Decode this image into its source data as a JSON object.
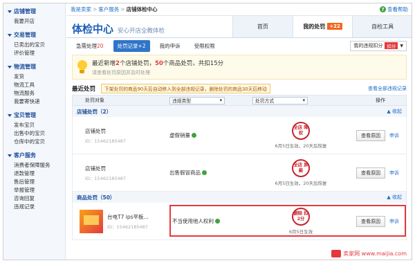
{
  "sidebar": {
    "sections": [
      {
        "title": "店铺管理",
        "items": [
          "我要开店"
        ]
      },
      {
        "title": "交易管理",
        "items": [
          "已卖出的宝贝",
          "评价管理"
        ]
      },
      {
        "title": "物流管理",
        "items": [
          "发货",
          "物流工具",
          "物流服务",
          "我要寄快递"
        ]
      },
      {
        "title": "宝贝管理",
        "items": [
          "发布宝贝",
          "出售中的宝贝",
          "仓库中的宝贝"
        ]
      },
      {
        "title": "客户服务",
        "items": [
          "消费者保障服务",
          "退款管理",
          "售后管理",
          "举报管理",
          "咨询回复",
          "违规记录"
        ]
      }
    ]
  },
  "breadcrumb": {
    "home": "我是卖家",
    "level2": "客户服务",
    "current": "店铺体检中心",
    "sep": ">"
  },
  "help_label": "查看帮助",
  "header": {
    "title": "体检中心",
    "subtitle": "安心开店全教体检"
  },
  "tabs": [
    {
      "label": "首页"
    },
    {
      "label": "我的处罚",
      "count": "+22"
    },
    {
      "label": "自检工具"
    }
  ],
  "subtabs": [
    {
      "label": "急需处理",
      "count": "20"
    },
    {
      "label": "处罚记录+2"
    },
    {
      "label": "我的申诉"
    },
    {
      "label": "受限权限"
    }
  ],
  "points_select": {
    "label": "我的违规扣分",
    "badge": "扣分"
  },
  "notice": {
    "prefix": "最近新增",
    "shop_count": "2",
    "mid": "个店铺处罚，",
    "item_count": "50",
    "suffix": "个商品处罚，共扣15分",
    "sub": "请查看处罚原因并及时处理"
  },
  "recent": {
    "title": "最近处罚",
    "tip": "下架处罚的商品90天后自动移入到全部违规记录，删除处罚的商品30天后移动",
    "all_link": "查看全部违规记录"
  },
  "table": {
    "col_object": "处罚对象",
    "col_type": "违规类型",
    "col_method": "处罚方式",
    "col_ops": "操作"
  },
  "groups": {
    "shop": {
      "title": "店铺处罚（2）",
      "fold": "收起"
    },
    "goods": {
      "title": "商品处罚（50）",
      "fold": "收起"
    }
  },
  "rows": [
    {
      "name": "店铺处罚",
      "id": "ID：15462185487",
      "type": "虚假销量",
      "stamp": "全店 降权",
      "note": "6月5日生效，20天后恢复",
      "btn": "查看原因",
      "appeal": "申诉"
    },
    {
      "name": "店铺处罚",
      "id": "ID：15462185487",
      "type": "出售假冒商品",
      "stamp": "全店 屏蔽",
      "note": "6月5日生效，20天后恢复",
      "btn": "查看原因",
      "appeal": "申诉"
    },
    {
      "name": "台电T7 ips平板...",
      "id": "ID：15462185487",
      "type": "不当使用他人权利",
      "stamp": "删除 扣2分",
      "note": "6月5日生效",
      "btn": "查看原因",
      "appeal": "申诉"
    }
  ],
  "watermark": {
    "text": "卖家网 www.maijia.com"
  },
  "colors": {
    "accent": "#1e5fb7",
    "alert": "#e4393c",
    "tab_badge": "#f2661f"
  }
}
